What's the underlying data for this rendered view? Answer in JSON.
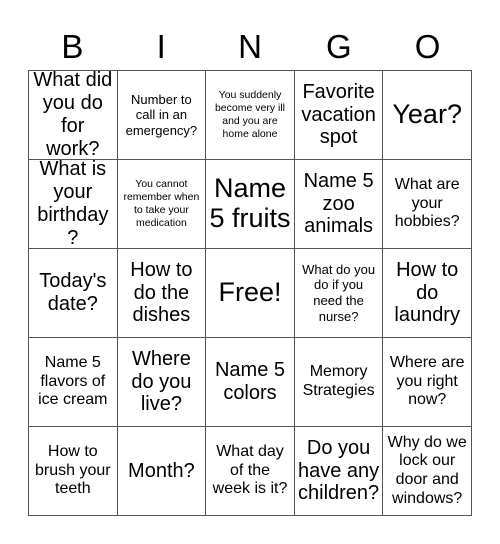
{
  "card": {
    "title": "BINGO",
    "header_letters": [
      "B",
      "I",
      "N",
      "G",
      "O"
    ],
    "colors": {
      "background": "#ffffff",
      "border": "#555555",
      "text": "#000000"
    },
    "grid": {
      "rows": 5,
      "columns": 5,
      "free_space_index": 12
    },
    "cells": [
      {
        "text": "What did you do for work?",
        "size": "l",
        "free": false
      },
      {
        "text": "Number to call in an emergency?",
        "size": "s",
        "free": false
      },
      {
        "text": "You suddenly become very ill and you are home alone",
        "size": "xs",
        "free": false
      },
      {
        "text": "Favorite vacation spot",
        "size": "l",
        "free": false
      },
      {
        "text": "Year?",
        "size": "xl",
        "free": false
      },
      {
        "text": "What is your birthday?",
        "size": "l",
        "free": false
      },
      {
        "text": "You cannot remember when to take your medication",
        "size": "xs",
        "free": false
      },
      {
        "text": "Name 5 fruits",
        "size": "xl",
        "free": false
      },
      {
        "text": "Name 5 zoo animals",
        "size": "l",
        "free": false
      },
      {
        "text": "What are your hobbies?",
        "size": "m",
        "free": false
      },
      {
        "text": "Today's date?",
        "size": "l",
        "free": false
      },
      {
        "text": "How to do the dishes",
        "size": "l",
        "free": false
      },
      {
        "text": "Free!",
        "size": "xl",
        "free": true
      },
      {
        "text": "What do you do if you need the nurse?",
        "size": "s",
        "free": false
      },
      {
        "text": "How to do laundry",
        "size": "l",
        "free": false
      },
      {
        "text": "Name 5 flavors of ice cream",
        "size": "m",
        "free": false
      },
      {
        "text": "Where do you live?",
        "size": "l",
        "free": false
      },
      {
        "text": "Name 5 colors",
        "size": "l",
        "free": false
      },
      {
        "text": "Memory Strategies",
        "size": "m",
        "free": false
      },
      {
        "text": "Where are you right now?",
        "size": "m",
        "free": false
      },
      {
        "text": "How to brush your teeth",
        "size": "m",
        "free": false
      },
      {
        "text": "Month?",
        "size": "l",
        "free": false
      },
      {
        "text": "What day of the week is it?",
        "size": "m",
        "free": false
      },
      {
        "text": "Do you have any children?",
        "size": "l",
        "free": false
      },
      {
        "text": "Why do we lock our door and windows?",
        "size": "m",
        "free": false
      }
    ]
  }
}
